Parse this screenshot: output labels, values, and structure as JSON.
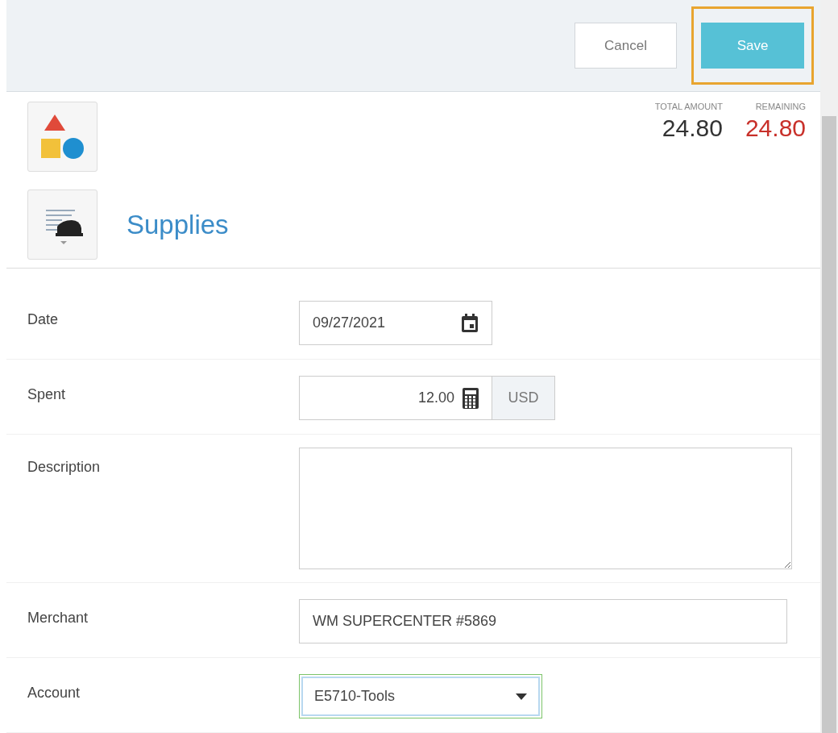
{
  "toolbar": {
    "buttons": [
      {
        "label": "Cancel",
        "kind": "secondary",
        "highlighted": false
      },
      {
        "label": "Save",
        "kind": "primary",
        "highlighted": true
      }
    ]
  },
  "summary": {
    "totals": [
      {
        "label": "TOTAL AMOUNT",
        "value": "24.80",
        "kind": "total"
      },
      {
        "label": "REMAINING",
        "value": "24.80",
        "kind": "remaining"
      }
    ],
    "category": "Supplies"
  },
  "fields": [
    {
      "label": "Date",
      "kind": "date",
      "value": "09/27/2021",
      "focused": false
    },
    {
      "label": "Spent",
      "kind": "amount",
      "value": "12.00",
      "currency": "USD",
      "focused": false
    },
    {
      "label": "Description",
      "kind": "textarea",
      "focused": false
    },
    {
      "label": "Merchant",
      "kind": "text",
      "value": "WM SUPERCENTER #5869",
      "focused": false
    },
    {
      "label": "Account",
      "kind": "select",
      "value": "E5710-Tools",
      "focused": true
    }
  ]
}
